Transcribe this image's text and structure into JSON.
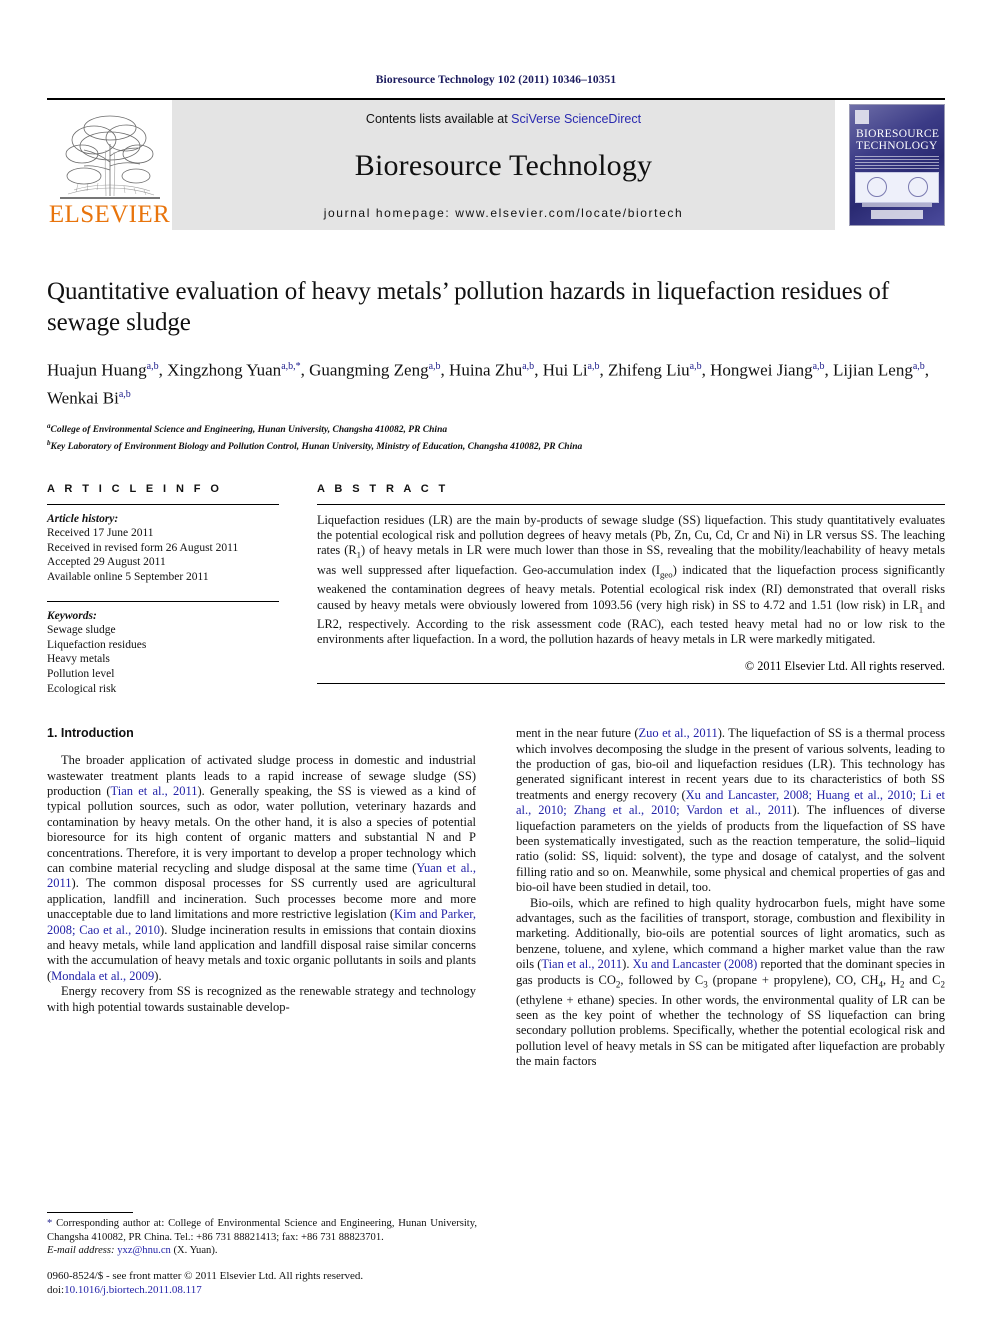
{
  "running_head": "Bioresource Technology 102 (2011) 10346–10351",
  "masthead": {
    "publisher_name": "ELSEVIER",
    "contents_prefix": "Contents lists available at ",
    "contents_link": "SciVerse ScienceDirect",
    "journal_name": "Bioresource Technology",
    "homepage": "journal homepage: www.elsevier.com/locate/biortech",
    "cover_title_line1": "BIORESOURCE",
    "cover_title_line2": "TECHNOLOGY"
  },
  "article": {
    "title": "Quantitative evaluation of heavy metals’ pollution hazards in liquefaction residues of sewage sludge",
    "authors": [
      {
        "name": "Huajun Huang",
        "sup": "a,b",
        "corresponding": false
      },
      {
        "name": "Xingzhong Yuan",
        "sup": "a,b,",
        "corresponding": true
      },
      {
        "name": "Guangming Zeng",
        "sup": "a,b",
        "corresponding": false
      },
      {
        "name": "Huina Zhu",
        "sup": "a,b",
        "corresponding": false
      },
      {
        "name": "Hui Li",
        "sup": "a,b",
        "corresponding": false
      },
      {
        "name": "Zhifeng Liu",
        "sup": "a,b",
        "corresponding": false
      },
      {
        "name": "Hongwei Jiang",
        "sup": "a,b",
        "corresponding": false
      },
      {
        "name": "Lijian Leng",
        "sup": "a,b",
        "corresponding": false
      },
      {
        "name": "Wenkai Bi",
        "sup": "a,b",
        "corresponding": false
      }
    ],
    "affiliations": [
      {
        "marker": "a",
        "text": "College of Environmental Science and Engineering, Hunan University, Changsha 410082, PR China"
      },
      {
        "marker": "b",
        "text": "Key Laboratory of Environment Biology and Pollution Control, Hunan University, Ministry of Education, Changsha 410082, PR China"
      }
    ]
  },
  "article_info": {
    "heading": "A R T I C L E   I N F O",
    "history_label": "Article history:",
    "history": [
      "Received 17 June 2011",
      "Received in revised form 26 August 2011",
      "Accepted 29 August 2011",
      "Available online 5 September 2011"
    ],
    "keywords_label": "Keywords:",
    "keywords": [
      "Sewage sludge",
      "Liquefaction residues",
      "Heavy metals",
      "Pollution level",
      "Ecological risk"
    ]
  },
  "abstract": {
    "heading": "A B S T R A C T",
    "paragraphs": [
      "Liquefaction residues (LR) are the main by-products of sewage sludge (SS) liquefaction. This study quantitatively evaluates the potential ecological risk and pollution degrees of heavy metals (Pb, Zn, Cu, Cd, Cr and Ni) in LR versus SS. The leaching rates (R1) of heavy metals in LR were much lower than those in SS, revealing that the mobility/leachability of heavy metals was well suppressed after liquefaction. Geo-accumulation index (Igeo) indicated that the liquefaction process significantly weakened the contamination degrees of heavy metals. Potential ecological risk index (RI) demonstrated that overall risks caused by heavy metals were obviously lowered from 1093.56 (very high risk) in SS to 4.72 and 1.51 (low risk) in LR1 and LR2, respectively. According to the risk assessment code (RAC), each tested heavy metal had no or low risk to the environments after liquefaction. In a word, the pollution hazards of heavy metals in LR were markedly mitigated."
    ],
    "copyright": "© 2011 Elsevier Ltd. All rights reserved."
  },
  "body": {
    "section1_heading": "1. Introduction",
    "left_paragraph_1_a": "The broader application of activated sludge process in domestic and industrial wastewater treatment plants leads to a rapid increase of sewage sludge (SS) production (",
    "left_paragraph_1_ref1": "Tian et al., 2011",
    "left_paragraph_1_b": "). Generally speaking, the SS is viewed as a kind of typical pollution sources, such as odor, water pollution, veterinary hazards and contamination by heavy metals. On the other hand, it is also a species of potential bioresource for its high content of organic matters and substantial N and P concentrations. Therefore, it is very important to develop a proper technology which can combine material recycling and sludge disposal at the same time (",
    "left_paragraph_1_ref2": "Yuan et al., 2011",
    "left_paragraph_1_c": "). The common disposal processes for SS currently used are agricultural application, landfill and incineration. Such processes become more and more unacceptable due to land limitations and more restrictive legislation (",
    "left_paragraph_1_ref3": "Kim and Parker, 2008; Cao et al., 2010",
    "left_paragraph_1_d": "). Sludge incineration results in emissions that contain dioxins and heavy metals, while land application and landfill disposal raise similar concerns with the accumulation of heavy metals and toxic organic pollutants in soils and plants (",
    "left_paragraph_1_ref4": "Mondala et al., 2009",
    "left_paragraph_1_e": ").",
    "left_paragraph_2_a": "Energy recovery from SS is recognized as the renewable strategy and technology with high potential towards sustainable develop-",
    "right_paragraph_1_a": "ment in the near future (",
    "right_paragraph_1_ref1": "Zuo et al., 2011",
    "right_paragraph_1_b": "). The liquefaction of SS is a thermal process which involves decomposing the sludge in the present of various solvents, leading to the production of gas, bio-oil and liquefaction residues (LR). This technology has generated significant interest in recent years due to its characteristics of both SS treatments and energy recovery (",
    "right_paragraph_1_ref2": "Xu and Lancaster, 2008; Huang et al., 2010; Li et al., 2010; Zhang et al., 2010; Vardon et al., 2011",
    "right_paragraph_1_c": "). The influences of diverse liquefaction parameters on the yields of products from the liquefaction of SS have been systematically investigated, such as the reaction temperature, the solid–liquid ratio (solid: SS, liquid: solvent), the type and dosage of catalyst, and the solvent filling ratio and so on. Meanwhile, some physical and chemical properties of gas and bio-oil have been studied in detail, too.",
    "right_paragraph_2_a": "Bio-oils, which are refined to high quality hydrocarbon fuels, might have some advantages, such as the facilities of transport, storage, combustion and flexibility in marketing. Additionally, bio-oils are potential sources of light aromatics, such as benzene, toluene, and xylene, which command a higher market value than the raw oils (",
    "right_paragraph_2_ref1": "Tian et al., 2011",
    "right_paragraph_2_b": "). ",
    "right_paragraph_2_ref2": "Xu and Lancaster (2008)",
    "right_paragraph_2_c": " reported that the dominant species in gas products is CO2, followed by C3 (propane + propylene), CO, CH4, H2 and C2 (ethylene + ethane) species. In other words, the environmental quality of LR can be seen as the key point of whether the technology of SS liquefaction can bring secondary pollution problems. Specifically, whether the potential ecological risk and pollution level of heavy metals in SS can be mitigated after liquefaction are probably the main factors"
  },
  "footnote": {
    "star": "*",
    "corresponding_text": "Corresponding author at: College of Environmental Science and Engineering, Hunan University, Changsha 410082, PR China. Tel.: +86 731 88821413; fax: +86 731 88823701.",
    "email_label": "E-mail address:",
    "email": "yxz@hnu.cn",
    "email_owner": "(X. Yuan).",
    "issn_line": "0960-8524/$ - see front matter © 2011 Elsevier Ltd. All rights reserved.",
    "doi_label": "doi:",
    "doi": "10.1016/j.biortech.2011.08.117"
  }
}
